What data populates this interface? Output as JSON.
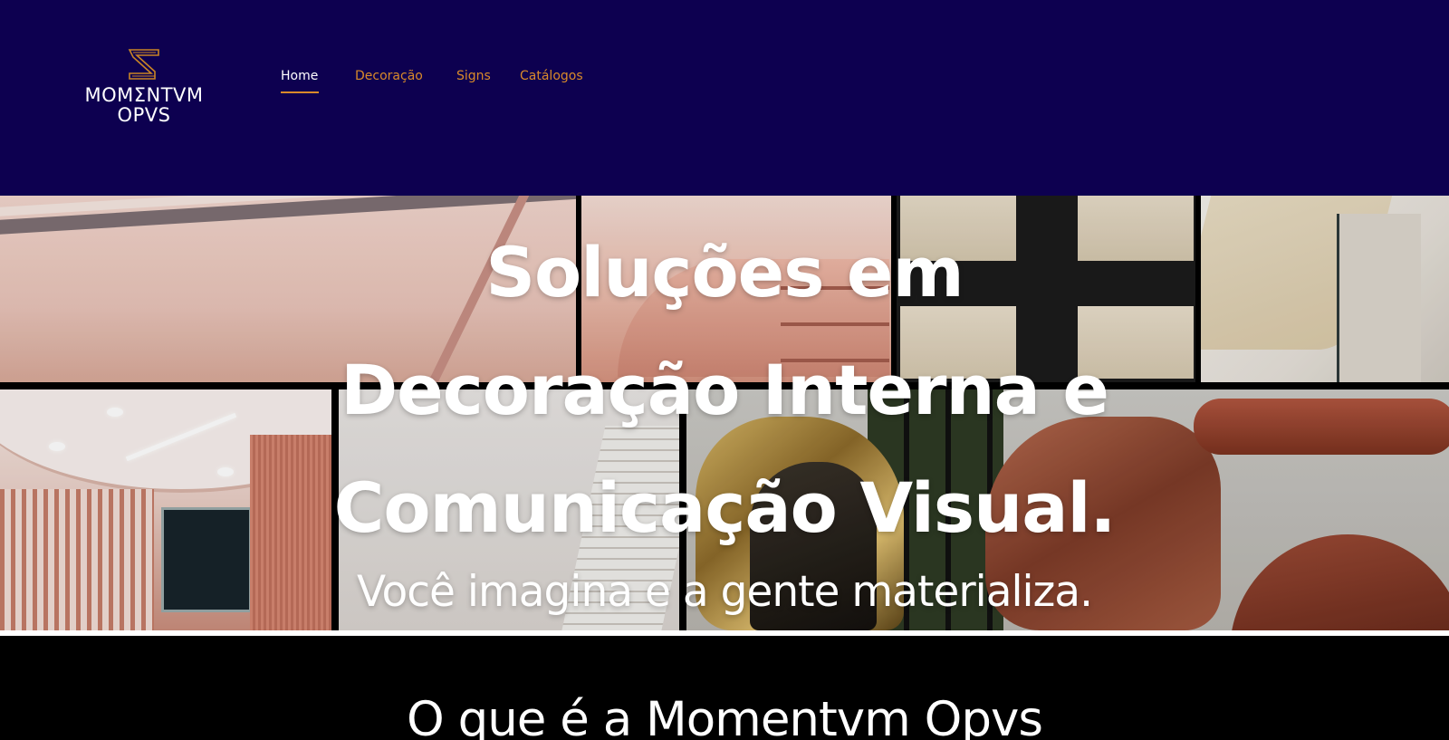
{
  "brand": {
    "logo_line_1": "MOMΣNTVM",
    "logo_line_2": "OPVS",
    "icon": "s-monogram-icon"
  },
  "nav": {
    "items": [
      {
        "label": "Home",
        "active": true
      },
      {
        "label": "Decoração",
        "active": false
      },
      {
        "label": "Signs",
        "active": false
      },
      {
        "label": "Catálogos",
        "active": false
      }
    ]
  },
  "hero": {
    "title_lines": [
      "Soluções em",
      "Decoração Interna e",
      "Comunicação Visual."
    ],
    "subtitle": "Você imagina e a gente materializa."
  },
  "about": {
    "title": "O que é a Momentvm Opvs"
  },
  "colors": {
    "header_bg": "#0d0050",
    "accent": "#d98a2a",
    "section_bg": "#000000",
    "text": "#ffffff"
  }
}
